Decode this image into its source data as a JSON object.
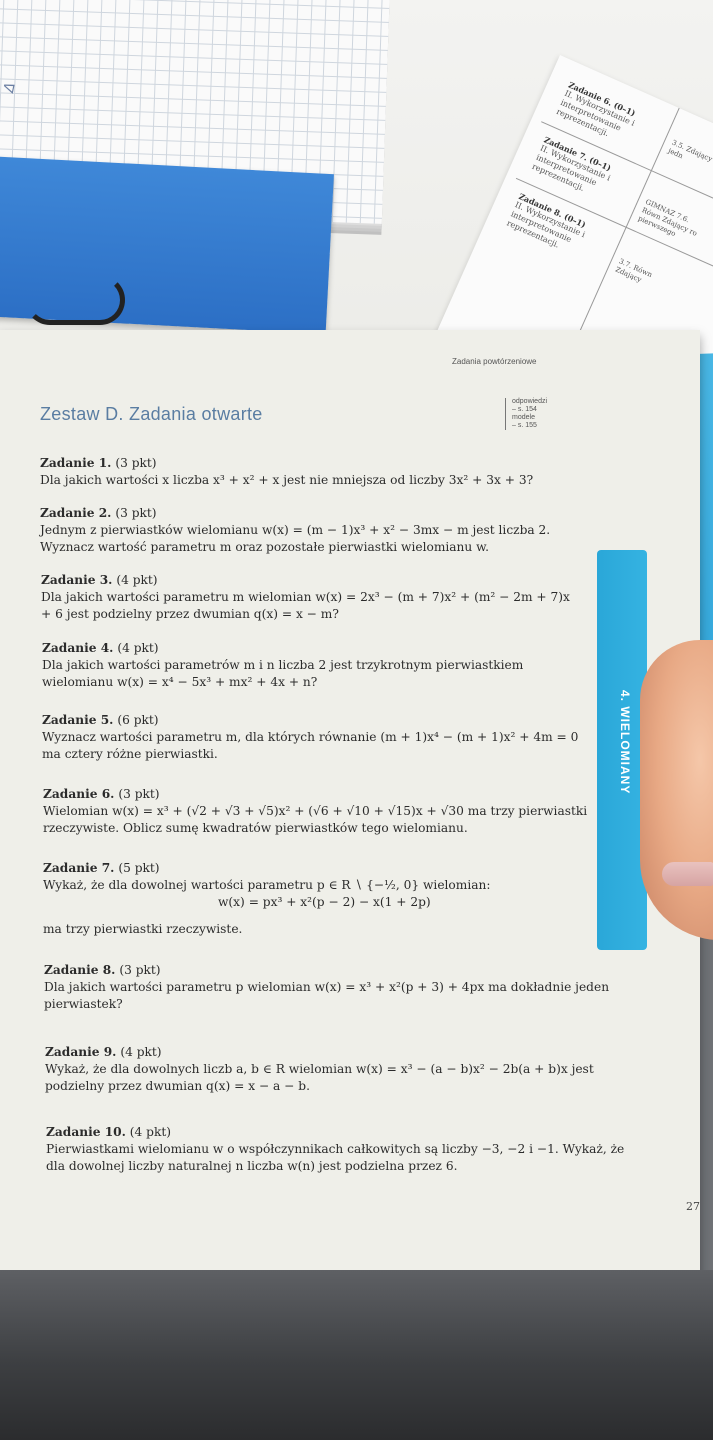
{
  "handwritten_notes": [
    "Δ"
  ],
  "answer_sheet": {
    "rows": [
      {
        "task": "Zadanie 6. (0–1)",
        "requirement": "II. Wykorzystanie i interpretowanie reprezentacji."
      },
      {
        "task": "Zadanie 7. (0–1)",
        "requirement": "II. Wykorzystanie i interpretowanie reprezentacji."
      },
      {
        "task": "Zadanie 8. (0–1)",
        "requirement": "II. Wykorzystanie i interpretowanie reprezentacji."
      }
    ],
    "right_notes": [
      "3.5. Zdający z jedn",
      "GIMNAZ 7.6. Równ Zdający ro pierwszego",
      "3.7. Równ Zdający"
    ]
  },
  "page": {
    "running_head": "Zadania powtórzeniowe",
    "set_title": "Zestaw D.  Zadania otwarte",
    "answers_ref": [
      "odpowiedzi",
      "– s. 154",
      "modele",
      "– s. 155"
    ],
    "side_tab": "4. WIELOMIANY",
    "page_number": "27",
    "tasks": [
      {
        "head": "Zadanie 1.",
        "points": "(3 pkt)",
        "body": "Dla jakich wartości x liczba x³ + x² + x jest nie mniejsza od liczby 3x² + 3x + 3?"
      },
      {
        "head": "Zadanie 2.",
        "points": "(3 pkt)",
        "body": "Jednym z pierwiastków wielomianu w(x) = (m − 1)x³ + x² − 3mx − m jest liczba 2. Wyznacz wartość parametru m oraz pozostałe pierwiastki wielomianu w."
      },
      {
        "head": "Zadanie 3.",
        "points": "(4 pkt)",
        "body": "Dla jakich wartości parametru m wielomian w(x) = 2x³ − (m + 7)x² + (m² − 2m + 7)x + 6 jest podzielny przez dwumian q(x) = x − m?"
      },
      {
        "head": "Zadanie 4.",
        "points": "(4 pkt)",
        "body": "Dla jakich wartości parametrów m i n liczba 2 jest trzykrotnym pierwiastkiem wielomianu w(x) = x⁴ − 5x³ + mx² + 4x + n?"
      },
      {
        "head": "Zadanie 5.",
        "points": "(6 pkt)",
        "body": "Wyznacz wartości parametru m, dla których równanie (m + 1)x⁴ − (m + 1)x² + 4m = 0 ma cztery różne pierwiastki."
      },
      {
        "head": "Zadanie 6.",
        "points": "(3 pkt)",
        "body": "Wielomian w(x) = x³ + (√2 + √3 + √5)x² + (√6 + √10 + √15)x + √30 ma trzy pierwiastki rzeczywiste. Oblicz sumę kwadratów pierwiastków tego wielomianu."
      },
      {
        "head": "Zadanie 7.",
        "points": "(5 pkt)",
        "body": "Wykaż, że dla dowolnej wartości parametru p ∈ R ∖ {−½, 0} wielomian:",
        "formula": "w(x) = px³ + x²(p − 2) − x(1 + 2p)",
        "after": "ma trzy pierwiastki rzeczywiste."
      },
      {
        "head": "Zadanie 8.",
        "points": "(3 pkt)",
        "body": "Dla jakich wartości parametru p wielomian w(x) = x³ + x²(p + 3) + 4px ma dokładnie jeden pierwiastek?"
      },
      {
        "head": "Zadanie 9.",
        "points": "(4 pkt)",
        "body": "Wykaż, że dla dowolnych liczb a, b ∈ R wielomian w(x) = x³ − (a − b)x² − 2b(a + b)x jest podzielny przez dwumian q(x) = x − a − b."
      },
      {
        "head": "Zadanie 10.",
        "points": "(4 pkt)",
        "body": "Pierwiastkami wielomianu w o współczynnikach całkowitych są liczby −3, −2 i −1. Wykaż, że dla dowolnej liczby naturalnej n liczba w(n) jest podzielna przez 6."
      }
    ]
  }
}
